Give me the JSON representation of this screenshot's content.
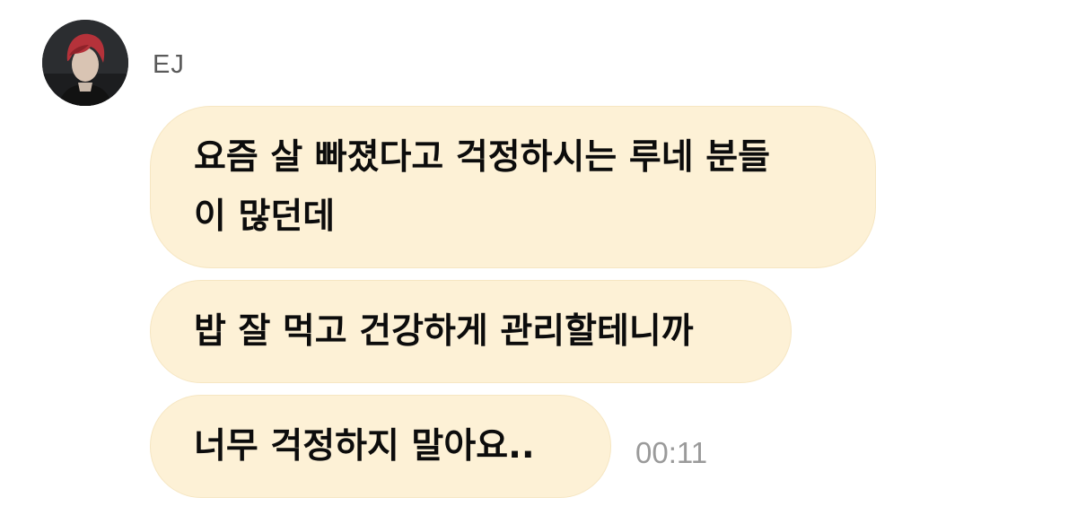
{
  "chat": {
    "sender": {
      "name": "EJ",
      "avatar_icon": "profile-photo"
    },
    "messages": [
      {
        "lines": [
          "요즘 살 빠졌다고 걱정하시는 루네 분들",
          "이 많던데"
        ]
      },
      {
        "lines": [
          "밥 잘 먹고 건강하게 관리할테니까"
        ]
      },
      {
        "lines": [
          "너무 걱정하지 말아요.."
        ]
      }
    ],
    "timestamp": "00:11"
  },
  "colors": {
    "bubble_background": "#fdf1d6",
    "message_text": "#0c0c0c",
    "sender_name": "#5a5a5a",
    "timestamp": "#9a9a9a"
  }
}
